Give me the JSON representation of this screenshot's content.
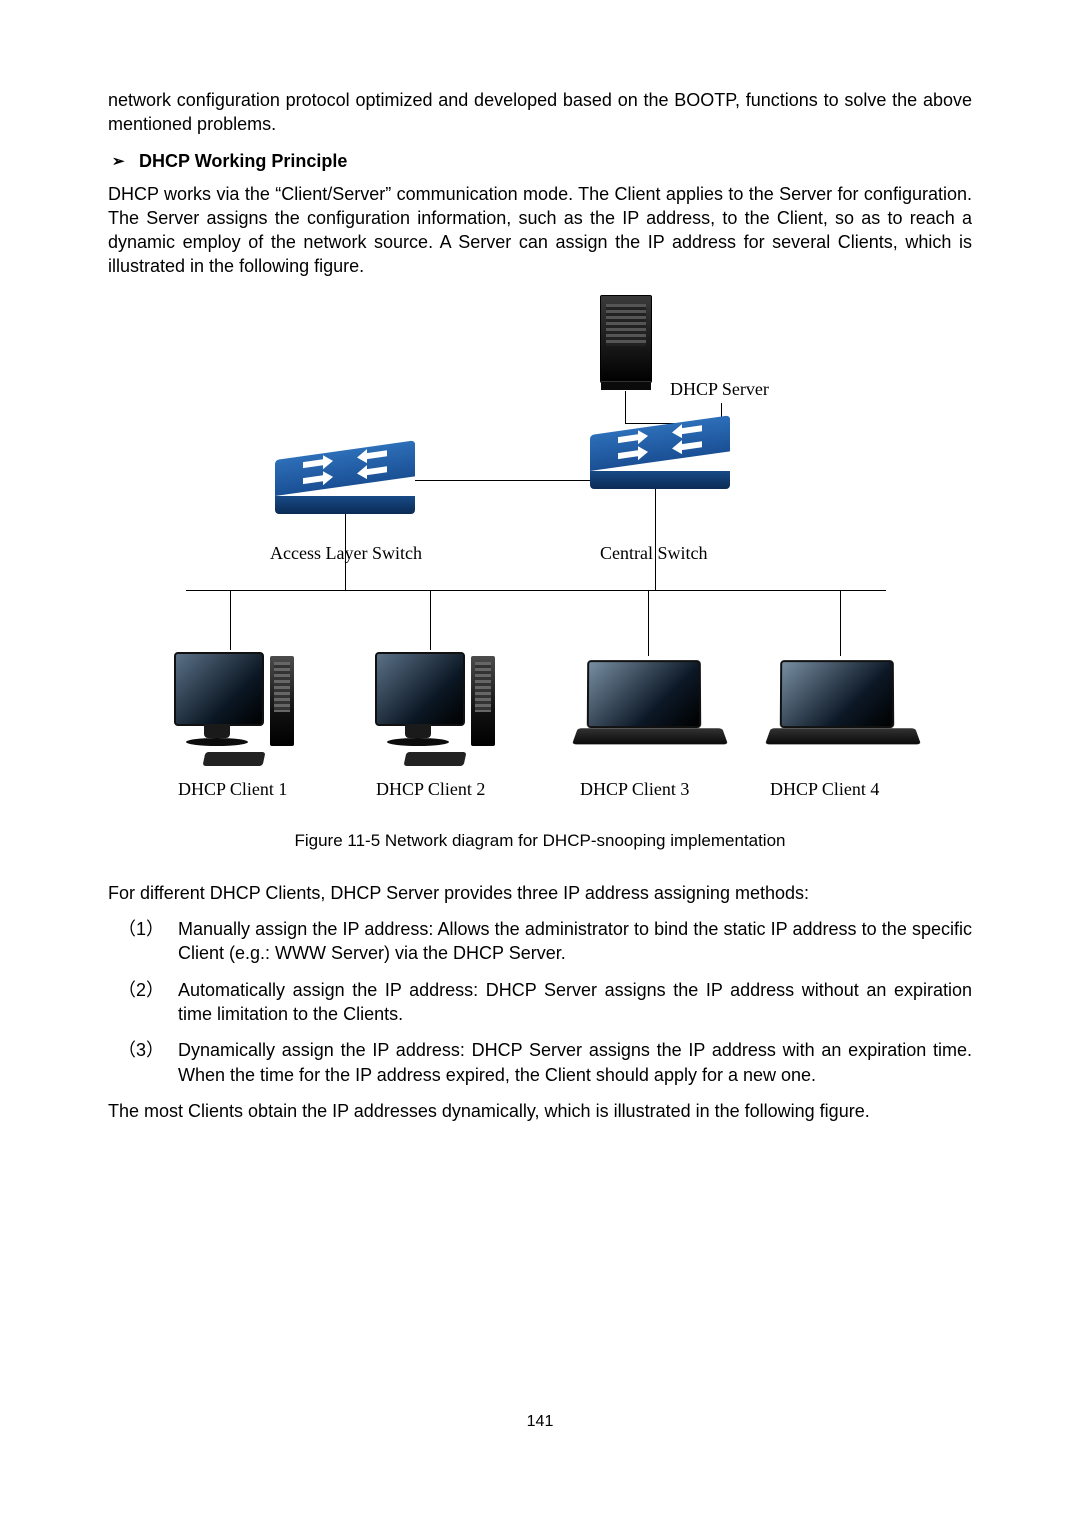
{
  "para1": "network configuration protocol optimized and developed based on the BOOTP, functions to solve the above mentioned problems.",
  "section_arrow": "➢",
  "section_title": "DHCP Working Principle",
  "para2": "DHCP works via the “Client/Server” communication mode. The Client applies to the Server for configuration. The Server assigns the configuration information, such as the IP address, to the Client, so as to reach a dynamic employ of the network source. A Server can assign the IP address for several Clients, which is illustrated in the following figure.",
  "diagram": {
    "server_label": "DHCP Server",
    "access_switch_label": "Access Layer Switch",
    "central_switch_label": "Central Switch",
    "client1_label": "DHCP Client 1",
    "client2_label": "DHCP Client 2",
    "client3_label": "DHCP Client 3",
    "client4_label": "DHCP Client 4"
  },
  "figure_caption": "Figure 11-5 Network diagram for DHCP-snooping implementation",
  "para3": "For different DHCP Clients, DHCP Server provides three IP address assigning methods:",
  "list": {
    "marker1": "（1）",
    "item1": "Manually assign the IP address: Allows the administrator to bind the static IP address to the specific Client (e.g.: WWW Server) via the DHCP Server.",
    "marker2": "（2）",
    "item2": "Automatically assign the IP address: DHCP Server assigns the IP address without an expiration time limitation to the Clients.",
    "marker3": "（3）",
    "item3": "Dynamically assign the IP address: DHCP Server assigns the IP address with an expiration time. When the time for the IP address expired, the Client should apply for a new one."
  },
  "para4": "The most Clients obtain the IP addresses dynamically, which is illustrated in the following figure.",
  "page_number": "141"
}
